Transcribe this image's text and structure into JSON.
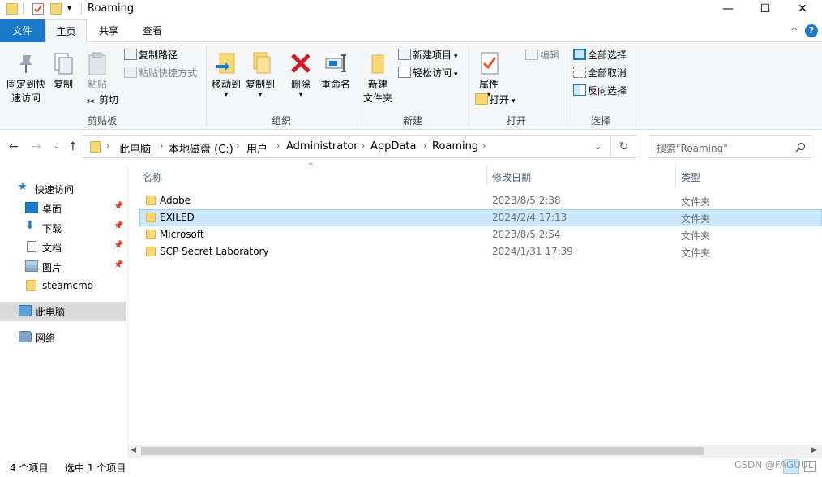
{
  "window": {
    "title": "Roaming",
    "minimize": "—",
    "maximize": "☐",
    "close": "✕"
  },
  "ribbon_tabs": {
    "file": "文件",
    "home": "主页",
    "share": "共享",
    "view": "查看",
    "collapse": "^",
    "help": "?"
  },
  "ribbon": {
    "clipboard": {
      "group_label": "剪贴板",
      "pin_quick_access": [
        "固定到快",
        "速访问"
      ],
      "copy": "复制",
      "paste": "粘贴",
      "copy_path": "复制路径",
      "paste_shortcut": "粘贴快捷方式",
      "cut": "剪切"
    },
    "organize": {
      "group_label": "组织",
      "move_to": "移动到",
      "copy_to": "复制到",
      "delete": "删除",
      "rename": "重命名"
    },
    "new": {
      "group_label": "新建",
      "new_folder": [
        "新建",
        "文件夹"
      ],
      "new_item": "新建项目",
      "easy_access": "轻松访问"
    },
    "open": {
      "group_label": "打开",
      "properties": "属性",
      "open": "打开",
      "edit": "编辑"
    },
    "select": {
      "group_label": "选择",
      "select_all": "全部选择",
      "select_none": "全部取消",
      "invert": "反向选择"
    }
  },
  "address": {
    "crumbs": [
      "此电脑",
      "本地磁盘 (C:)",
      "用户",
      "Administrator",
      "AppData",
      "Roaming"
    ],
    "search_placeholder": "搜索\"Roaming\""
  },
  "sidebar": {
    "quick_access": "快速访问",
    "items": [
      {
        "label": "桌面",
        "pinned": true,
        "icon": "desktop-icon"
      },
      {
        "label": "下载",
        "pinned": true,
        "icon": "download-icon"
      },
      {
        "label": "文档",
        "pinned": true,
        "icon": "document-icon"
      },
      {
        "label": "图片",
        "pinned": true,
        "icon": "picture-icon"
      },
      {
        "label": "steamcmd",
        "pinned": false,
        "icon": "folder-icon"
      }
    ],
    "this_pc": "此电脑",
    "network": "网络"
  },
  "columns": {
    "name": "名称",
    "modified": "修改日期",
    "type": "类型"
  },
  "files": [
    {
      "name": "Adobe",
      "modified": "2023/8/5 2:38",
      "type": "文件夹",
      "selected": false
    },
    {
      "name": "EXILED",
      "modified": "2024/2/4 17:13",
      "type": "文件夹",
      "selected": true
    },
    {
      "name": "Microsoft",
      "modified": "2023/8/5 2:54",
      "type": "文件夹",
      "selected": false
    },
    {
      "name": "SCP Secret Laboratory",
      "modified": "2024/1/31 17:39",
      "type": "文件夹",
      "selected": false
    }
  ],
  "status": {
    "count": "4 个项目",
    "selected": "选中 1 个项目"
  },
  "watermark": "CSDN @FAGUUL",
  "colors": {
    "accent": "#1979ca",
    "selection": "#cce8ff",
    "folder": "#f8d775"
  }
}
